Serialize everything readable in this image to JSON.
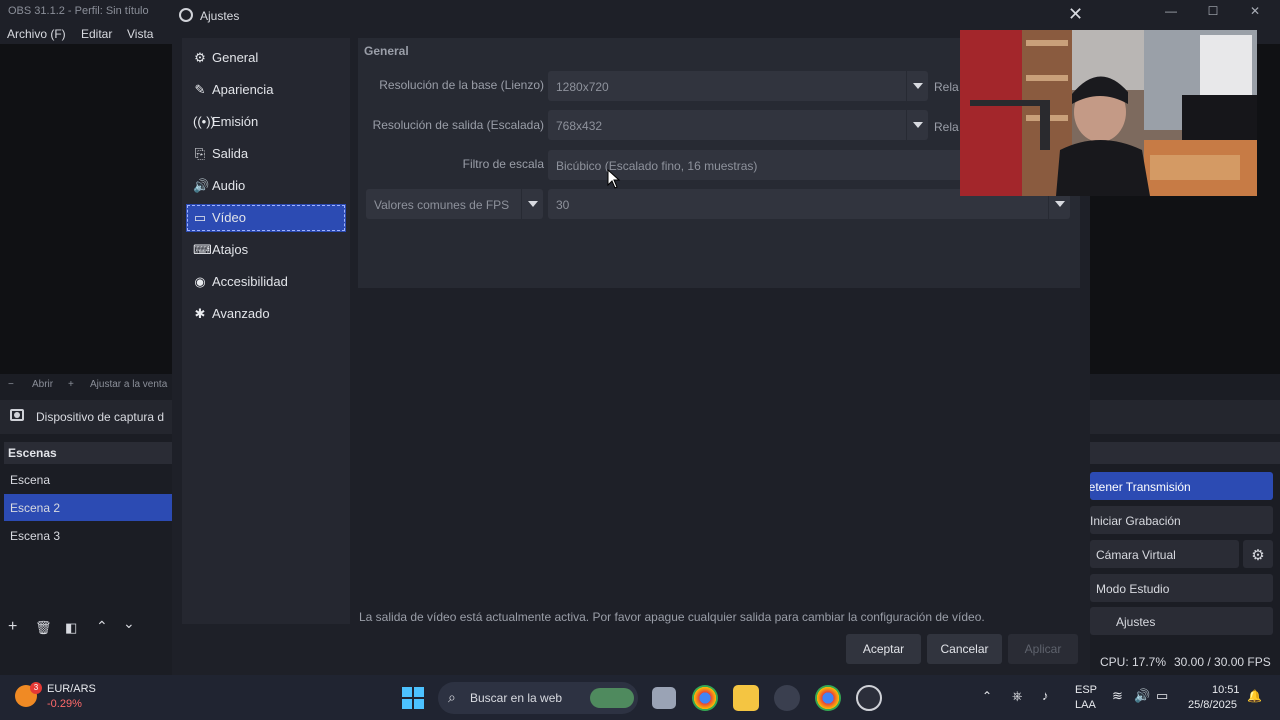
{
  "obs": {
    "window_title": "OBS 31.1.2 - Perfil: Sin título",
    "menu": [
      "Archivo (F)",
      "Editar",
      "Vista"
    ],
    "zoombar": [
      "Abrir",
      "Ajustar a la venta"
    ],
    "source_name": "Dispositivo de captura d",
    "scenes_header": "Escenas",
    "scenes": [
      "Escena",
      "Escena 2",
      "Escena 3"
    ],
    "controls": {
      "stream": "Detener Transmisión",
      "record": "Iniciar Grabación",
      "virtual_cam": "Cámara Virtual",
      "studio_mode": "Modo Estudio",
      "settings": "Ajustes"
    },
    "status": {
      "cpu": "CPU: 17.7%",
      "fps": "30.00 / 30.00 FPS"
    }
  },
  "dialog": {
    "title": "Ajustes",
    "nav": [
      {
        "label": "General",
        "icon": "gear-icon"
      },
      {
        "label": "Apariencia",
        "icon": "brush-icon"
      },
      {
        "label": "Emisión",
        "icon": "broadcast-icon"
      },
      {
        "label": "Salida",
        "icon": "output-icon"
      },
      {
        "label": "Audio",
        "icon": "speaker-icon"
      },
      {
        "label": "Vídeo",
        "icon": "monitor-icon"
      },
      {
        "label": "Atajos",
        "icon": "keyboard-icon"
      },
      {
        "label": "Accesibilidad",
        "icon": "accessibility-icon"
      },
      {
        "label": "Avanzado",
        "icon": "wrench-icon"
      }
    ],
    "selected_nav": "Vídeo",
    "group_title": "General",
    "base_label": "Resolución de la base (Lienzo)",
    "base_value": "1280x720",
    "base_aspect": "Rela",
    "output_label": "Resolución de salida (Escalada)",
    "output_value": "768x432",
    "output_aspect": "Rela",
    "filter_label": "Filtro de escala",
    "filter_value": "Bicúbico (Escalado fino, 16 muestras)",
    "fps_type": "Valores comunes de FPS",
    "fps_value": "30",
    "warning": "La salida de vídeo está actualmente activa. Por favor apague cualquier salida para cambiar la configuración de vídeo.",
    "buttons": {
      "accept": "Aceptar",
      "cancel": "Cancelar",
      "apply": "Aplicar"
    }
  },
  "taskbar": {
    "weather_title": "EUR/ARS",
    "weather_change": "-0.29%",
    "weather_badge": "3",
    "search_placeholder": "Buscar en la web",
    "lang_1": "ESP",
    "lang_2": "LAA",
    "time": "10:51",
    "date": "25/8/2025"
  },
  "colors": {
    "accent": "#2c4bb3",
    "dialog_bg": "#1e2028",
    "panel_bg": "#272a33"
  }
}
